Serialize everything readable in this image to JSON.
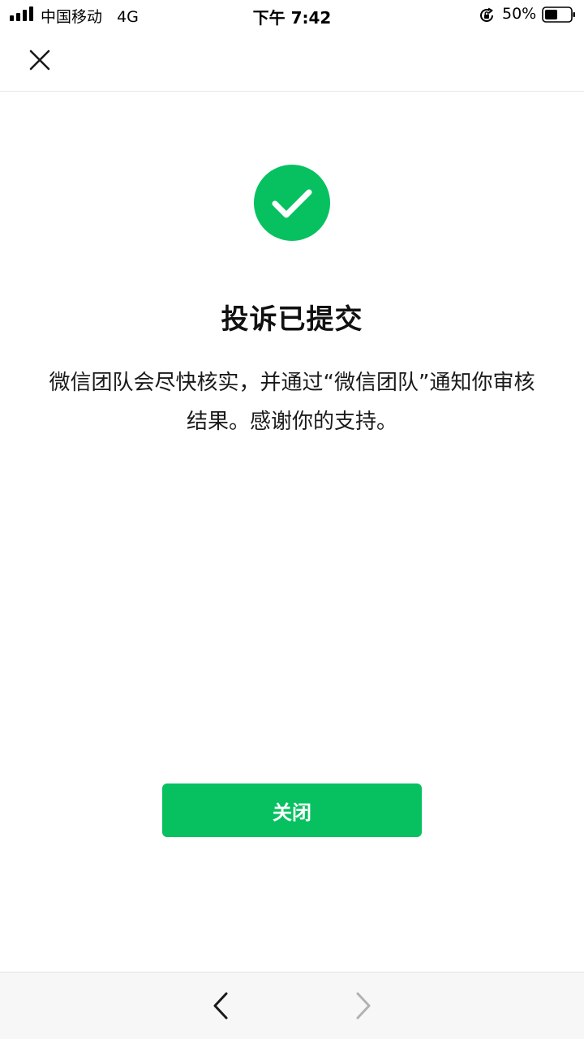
{
  "status_bar": {
    "carrier": "中国移动",
    "network": "4G",
    "time": "下午 7:42",
    "battery_percent": "50%",
    "battery_level": 0.5,
    "icons": [
      "signal-icon",
      "orientation-lock-icon",
      "battery-icon"
    ]
  },
  "nav": {
    "close_icon": "close-icon"
  },
  "result": {
    "icon": "check-circle-icon",
    "title": "投诉已提交",
    "description": "微信团队会尽快核实，并通过“微信团队”通知你审核结果。感谢你的支持。"
  },
  "actions": {
    "close_label": "关闭"
  },
  "toolbar": {
    "back_icon": "chevron-left-icon",
    "forward_icon": "chevron-right-icon",
    "forward_enabled": false
  },
  "colors": {
    "brand_green": "#07c160",
    "text": "#111111",
    "toolbar_bg": "#f7f7f7",
    "disabled_icon": "#b2b2b2"
  }
}
